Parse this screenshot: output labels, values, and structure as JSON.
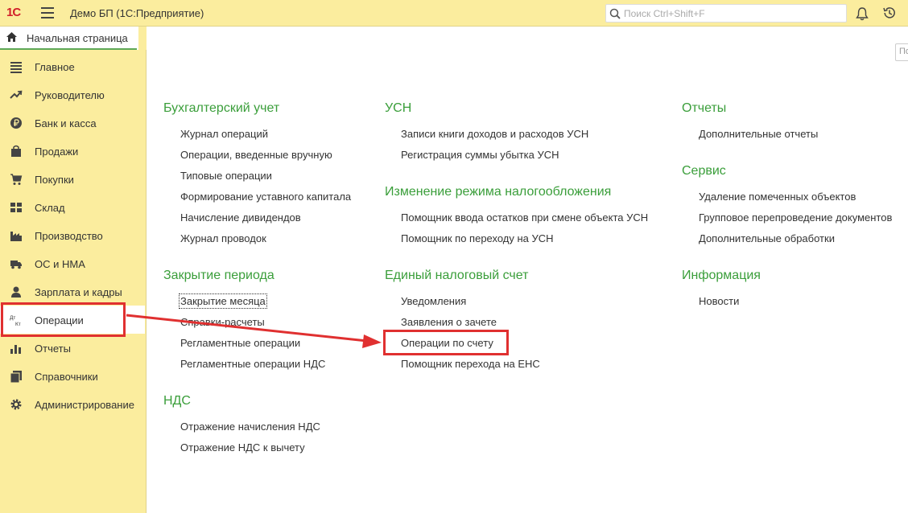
{
  "header": {
    "logo": "1С",
    "app_title": "Демо БП  (1С:Предприятие)",
    "search_placeholder": "Поиск Ctrl+Shift+F",
    "icons": [
      "menu-icon",
      "search-icon",
      "bell-icon",
      "history-icon"
    ]
  },
  "home_tab": {
    "label": "Начальная страница",
    "icon": "home-icon"
  },
  "sidebar": {
    "items": [
      {
        "label": "Главное",
        "icon": "list-icon"
      },
      {
        "label": "Руководителю",
        "icon": "trend-icon"
      },
      {
        "label": "Банк и касса",
        "icon": "ruble-icon"
      },
      {
        "label": "Продажи",
        "icon": "bag-icon"
      },
      {
        "label": "Покупки",
        "icon": "cart-icon"
      },
      {
        "label": "Склад",
        "icon": "warehouse-icon"
      },
      {
        "label": "Производство",
        "icon": "factory-icon"
      },
      {
        "label": "ОС и НМА",
        "icon": "truck-icon"
      },
      {
        "label": "Зарплата и кадры",
        "icon": "person-icon"
      },
      {
        "label": "Операции",
        "icon": "dt-kt-icon",
        "active": true
      },
      {
        "label": "Отчеты",
        "icon": "bar-chart-icon"
      },
      {
        "label": "Справочники",
        "icon": "books-icon"
      },
      {
        "label": "Администрирование",
        "icon": "gear-icon"
      }
    ]
  },
  "main": {
    "corner_label": "По",
    "groups": [
      {
        "title": "Бухгалтерский учет",
        "links": [
          "Журнал операций",
          "Операции, введенные вручную",
          "Типовые операции",
          "Формирование уставного капитала",
          "Начисление дивидендов",
          "Журнал проводок"
        ]
      },
      {
        "title": "Закрытие периода",
        "links": [
          "Закрытие месяца",
          "Справки-расчеты",
          "Регламентные операции",
          "Регламентные операции НДС"
        ]
      },
      {
        "title": "НДС",
        "links": [
          "Отражение начисления НДС",
          "Отражение НДС к вычету"
        ]
      },
      {
        "title": "УСН",
        "links": [
          "Записи книги доходов и расходов УСН",
          "Регистрация суммы убытка УСН"
        ]
      },
      {
        "title": "Изменение режима налогообложения",
        "links": [
          "Помощник ввода остатков при смене объекта УСН",
          "Помощник по переходу на УСН"
        ]
      },
      {
        "title": "Единый налоговый счет",
        "links": [
          "Уведомления",
          "Заявления о зачете",
          "Операции по счету",
          "Помощник перехода на ЕНС"
        ]
      },
      {
        "title": "Отчеты",
        "links": [
          "Дополнительные отчеты"
        ]
      },
      {
        "title": "Сервис",
        "links": [
          "Удаление помеченных объектов",
          "Групповое перепроведение документов",
          "Дополнительные обработки"
        ]
      },
      {
        "title": "Информация",
        "links": [
          "Новости"
        ]
      }
    ]
  },
  "colors": {
    "panel_yellow": "#fbed9e",
    "group_green": "#3a9e3a",
    "highlight_red": "#e03030",
    "logo_red": "#d1202a"
  }
}
